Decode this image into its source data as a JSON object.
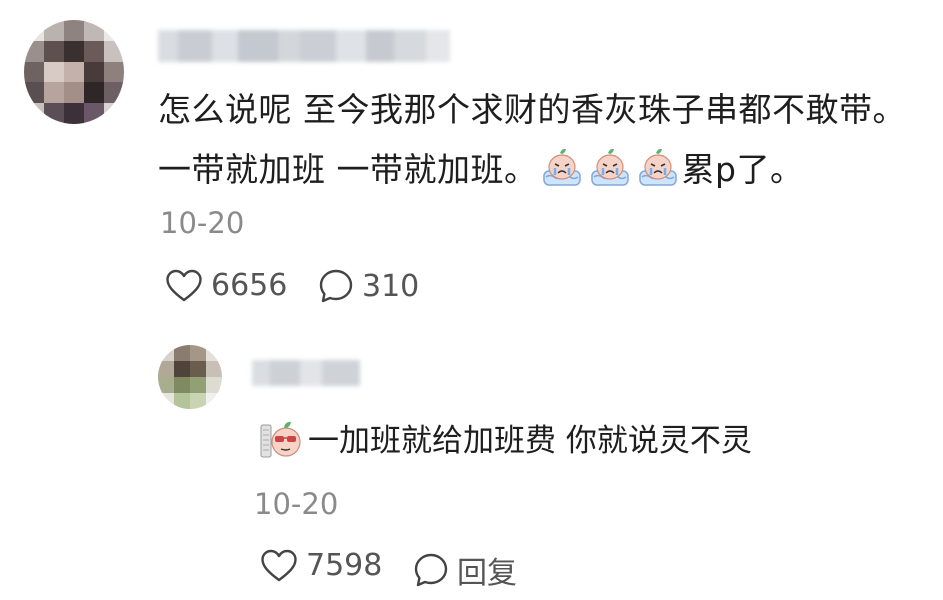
{
  "comment": {
    "text_part1": "怎么说呢 至今我那个求财的香灰珠子串都不敢带。一带就加班 一带就加班。",
    "text_part2": "累p了。",
    "emoji": "crying-sticker-icon",
    "date": "10-20",
    "likes": "6656",
    "replies": "310"
  },
  "reply": {
    "text": "一加班就给加班费 你就说灵不灵",
    "emoji": "sunglasses-sticker-icon",
    "date": "10-20",
    "likes": "7598",
    "reply_label": "回复"
  },
  "colors": {
    "text": "#1e1e1e",
    "meta": "#8a8a8a",
    "action": "#555555"
  }
}
